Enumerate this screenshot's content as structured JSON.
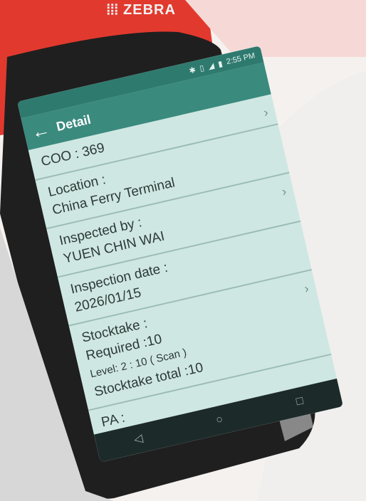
{
  "brand": {
    "name": "ZEBRA",
    "logo_icon": "zebra-logo-icon"
  },
  "status_bar": {
    "time": "2:55 PM"
  },
  "app_bar": {
    "title": "Detail",
    "back_icon": "back-arrow-icon"
  },
  "details": [
    {
      "lines": [
        "COO : 369"
      ]
    },
    {
      "lines": [
        "Location :",
        "China Ferry Terminal"
      ]
    },
    {
      "lines": [
        "Inspected by :",
        "YUEN CHIN WAI"
      ]
    },
    {
      "lines": [
        "Inspection date :",
        "2026/01/15"
      ]
    },
    {
      "lines": [
        "Stocktake :",
        "Required :10",
        "Level: 2 : 10 ( Scan )",
        "Stocktake total :10"
      ]
    },
    {
      "lines": [
        "PA :"
      ]
    }
  ],
  "nav_icons": [
    "back-triangle-icon",
    "home-circle-icon",
    "recents-square-icon"
  ]
}
